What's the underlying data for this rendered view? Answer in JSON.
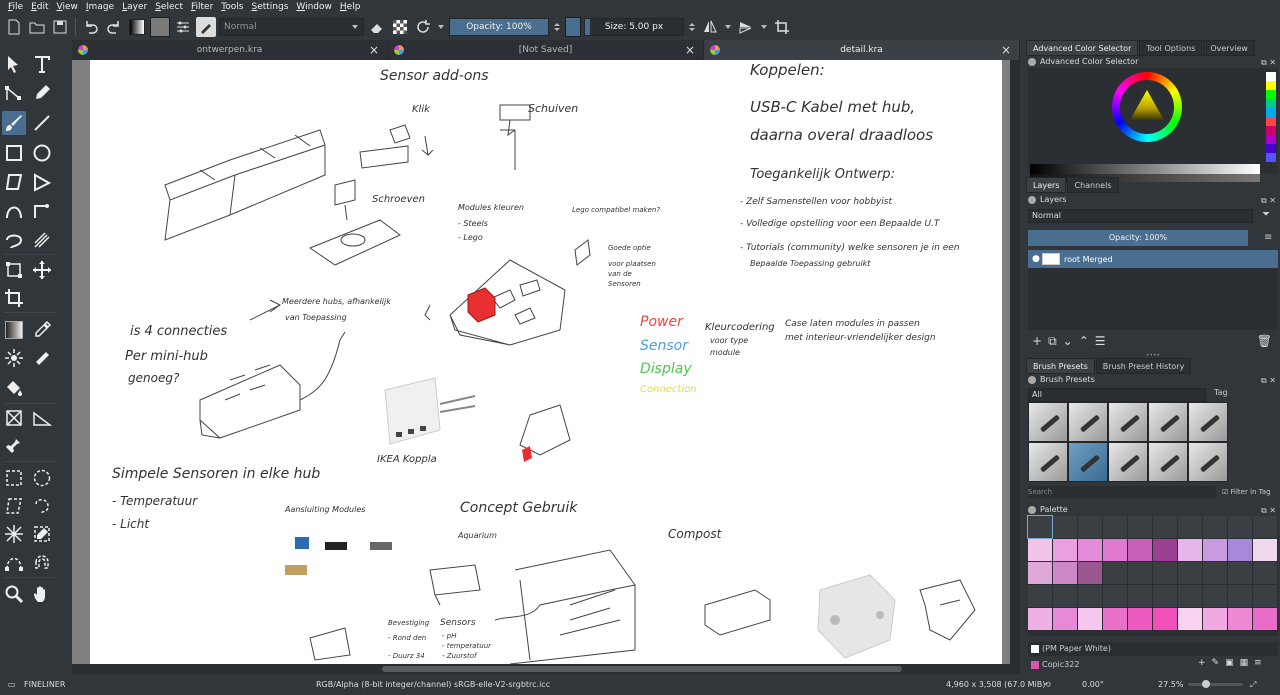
{
  "menubar": [
    "File",
    "Edit",
    "View",
    "Image",
    "Layer",
    "Select",
    "Filter",
    "Tools",
    "Settings",
    "Window",
    "Help"
  ],
  "toolbar": {
    "blend_mode": "Normal",
    "opacity_label": "Opacity: 100%",
    "opacity_fraction": 1.0,
    "size_label": "Size: 5.00 px",
    "size_fraction": 0.05,
    "fg_color": "#4a4a4a",
    "bg_color": "#7a7a7a"
  },
  "tabs": [
    {
      "title": "ontwerpen.kra"
    },
    {
      "title": "[Not Saved]"
    },
    {
      "title": "detail.kra"
    }
  ],
  "canvas_text": {
    "t1": "Sensor add-ons",
    "t2": "Klik",
    "t3": "Schuiven",
    "t4": "Schroeven",
    "t5": "Koppelen:",
    "t6": "USB-C Kabel met hub,",
    "t7": "daarna overal draadloos",
    "t8": "Toegankelijk Ontwerp:",
    "t9": "- Zelf Samenstellen voor hobbyist",
    "t10": "- Volledige opstelling voor een Bepaalde U.T",
    "t11": "- Tutorials (community) welke sensoren je in een",
    "t12": "Bepaalde Toepassing gebruikt",
    "t13": "Modules kleuren",
    "t14": "- Steels",
    "t15": "- Lego",
    "t16": "Lego compatibel maken?",
    "t17": "Goede optie",
    "t18": "voor plaatsen",
    "t19": "van de",
    "t20": "Sensoren",
    "t21": "is 4 connecties",
    "t22": "Per mini-hub",
    "t23": "genoeg?",
    "t24": "Meerdere hubs, afhankelijk",
    "t25": "van Toepassing",
    "t26": "Power",
    "t27": "Sensor",
    "t28": "Display",
    "t29": "Connection",
    "t30": "Kleurcodering",
    "t31": "voor type",
    "t32": "module",
    "t33": "Case laten modules in passen",
    "t34": "met interieur-vriendelijker design",
    "t35": "IKEA Koppla",
    "t36": "Simpele Sensoren in elke hub",
    "t37": "- Temperatuur",
    "t38": "- Licht",
    "t39": "Aansluiting Modules",
    "t40": "Concept Gebruik",
    "t41": "Aquarium",
    "t42": "Compost",
    "t43": "Sensors",
    "t44": "- pH",
    "t45": "- temperatuur",
    "t46": "- Zuurstof",
    "t47": "Bevestiging",
    "t48": "- Rond den",
    "t49": "- Duurz 34"
  },
  "colors": {
    "power": "#e8463c",
    "sensor": "#4a9fe0",
    "display": "#4dc84d",
    "connection": "#e8d84a",
    "accent": "#4a6e8f"
  },
  "right": {
    "tabs_top": [
      "Advanced Color Selector",
      "Tool Options",
      "Overview"
    ],
    "color_selector_title": "Advanced Color Selector",
    "layers_tabs": [
      "Layers",
      "Channels"
    ],
    "layers_title": "Layers",
    "layers_blend": "Normal",
    "layers_opacity": "Opacity:  100%",
    "layer_name": "root Merged",
    "brush_tabs": [
      "Brush Presets",
      "Brush Preset History"
    ],
    "brush_title": "Brush Presets",
    "brush_filter": "All",
    "brush_tag": "Tag",
    "search_placeholder": "Search",
    "filter_in_tag": "Filter in Tag",
    "palette_title": "Palette",
    "palette_color_name": "(PM Paper White)",
    "palette_set": "Copic322"
  },
  "palette_colors": [
    "#3a3f44",
    "#3a3f44",
    "#3a3f44",
    "#3a3f44",
    "#3a3f44",
    "#3a3f44",
    "#3a3f44",
    "#3a3f44",
    "#3a3f44",
    "#3a3f44",
    "#f2c4ec",
    "#e8a0e0",
    "#e58ad8",
    "#e07ad0",
    "#c860b8",
    "#9a3f92",
    "#e6b6ea",
    "#c89ae0",
    "#a888d8",
    "#f0d8ec",
    "#e0a8d8",
    "#cc88c8",
    "#9a5890",
    "#3a3f44",
    "#3a3f44",
    "#3a3f44",
    "#3a3f44",
    "#3a3f44",
    "#3a3f44",
    "#3a3f44",
    "#3a3f44",
    "#3a3f44",
    "#3a3f44",
    "#3a3f44",
    "#3a3f44",
    "#3a3f44",
    "#3a3f44",
    "#3a3f44",
    "#3a3f44",
    "#3a3f44",
    "#f0b0e6",
    "#e68ad8",
    "#f6c6ec",
    "#e870c8",
    "#ec5cc0",
    "#f050b8",
    "#f8d2ee",
    "#f2a8e0",
    "#ee88d4",
    "#e96ccb"
  ],
  "status": {
    "brush": "FINELINER",
    "color_space": "RGB/Alpha (8-bit integer/channel)  sRGB-elle-V2-srgbtrc.icc",
    "dimensions": "4,960 x 3,508 (67.0 MiB)",
    "rotation": "0.00°",
    "zoom": "27.5%"
  }
}
